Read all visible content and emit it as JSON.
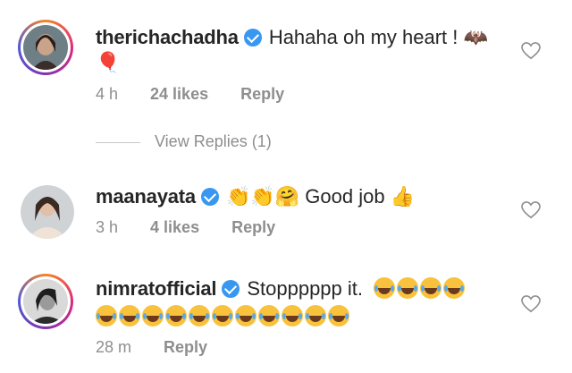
{
  "comments": [
    {
      "username": "therichachadha",
      "text": "Hahaha oh my heart !",
      "emojis_inline": "🦇",
      "emojis_line2": "🎈",
      "time": "4 h",
      "likes": "24 likes",
      "reply": "Reply",
      "view_replies": "View Replies (1)"
    },
    {
      "username": "maanayata",
      "emojis_inline": "👏👏🤗",
      "text": "Good job",
      "emojis_trailing": "👍",
      "time": "3 h",
      "likes": "4 likes",
      "reply": "Reply"
    },
    {
      "username": "nimratofficial",
      "text": "Stopppppp it.",
      "laugh_count_line1": 4,
      "laugh_count_line2": 11,
      "time": "28 m",
      "reply": "Reply"
    }
  ],
  "colors": {
    "verified": "#3897f0",
    "meta": "#8e8e8e",
    "text": "#262626"
  },
  "icons": [
    "verified-badge-icon",
    "heart-outline-icon",
    "avatar"
  ]
}
